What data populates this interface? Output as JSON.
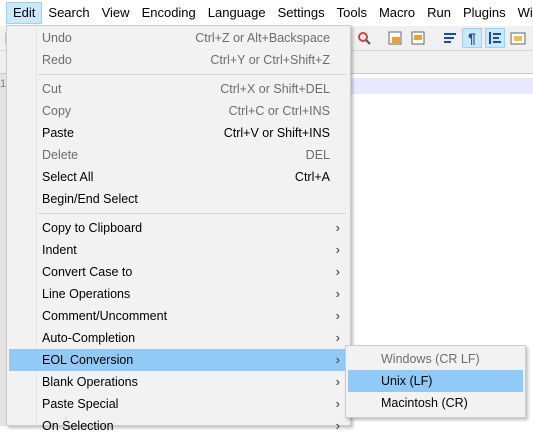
{
  "menubar": {
    "items": [
      "Edit",
      "Search",
      "View",
      "Encoding",
      "Language",
      "Settings",
      "Tools",
      "Macro",
      "Run",
      "Plugins",
      "Windo"
    ]
  },
  "gutter": {
    "line_number": "1"
  },
  "edit_menu": {
    "items": [
      {
        "label": "Undo",
        "shortcut": "Ctrl+Z or Alt+Backspace"
      },
      {
        "label": "Redo",
        "shortcut": "Ctrl+Y or Ctrl+Shift+Z"
      },
      {
        "label": "Cut",
        "shortcut": "Ctrl+X or Shift+DEL"
      },
      {
        "label": "Copy",
        "shortcut": "Ctrl+C or Ctrl+INS"
      },
      {
        "label": "Paste",
        "shortcut": "Ctrl+V or Shift+INS"
      },
      {
        "label": "Delete",
        "shortcut": "DEL"
      },
      {
        "label": "Select All",
        "shortcut": "Ctrl+A"
      },
      {
        "label": "Begin/End Select",
        "shortcut": ""
      },
      {
        "label": "Copy to Clipboard",
        "shortcut": "",
        "submenu_arrow": "›"
      },
      {
        "label": "Indent",
        "shortcut": "",
        "submenu_arrow": "›"
      },
      {
        "label": "Convert Case to",
        "shortcut": "",
        "submenu_arrow": "›"
      },
      {
        "label": "Line Operations",
        "shortcut": "",
        "submenu_arrow": "›"
      },
      {
        "label": "Comment/Uncomment",
        "shortcut": "",
        "submenu_arrow": "›"
      },
      {
        "label": "Auto-Completion",
        "shortcut": "",
        "submenu_arrow": "›"
      },
      {
        "label": "EOL Conversion",
        "shortcut": "",
        "submenu_arrow": "›"
      },
      {
        "label": "Blank Operations",
        "shortcut": "",
        "submenu_arrow": "›"
      },
      {
        "label": "Paste Special",
        "shortcut": "",
        "submenu_arrow": "›"
      },
      {
        "label": "On Selection",
        "shortcut": "",
        "submenu_arrow": "›"
      }
    ],
    "disabled_items": [
      "Undo",
      "Redo",
      "Cut",
      "Copy",
      "Delete"
    ],
    "highlighted_item": "EOL Conversion"
  },
  "eol_submenu": {
    "items": [
      {
        "label": "Windows (CR LF)"
      },
      {
        "label": "Unix (LF)"
      },
      {
        "label": "Macintosh (CR)"
      }
    ],
    "disabled_items": [
      "Windows (CR LF)"
    ],
    "highlighted_item": "Unix (LF)"
  },
  "colors": {
    "menu_highlight": "#91c9f7",
    "menubar_active": "#cce8ff",
    "disabled_text": "#6d6d6d",
    "menu_background": "#f2f2f2"
  }
}
